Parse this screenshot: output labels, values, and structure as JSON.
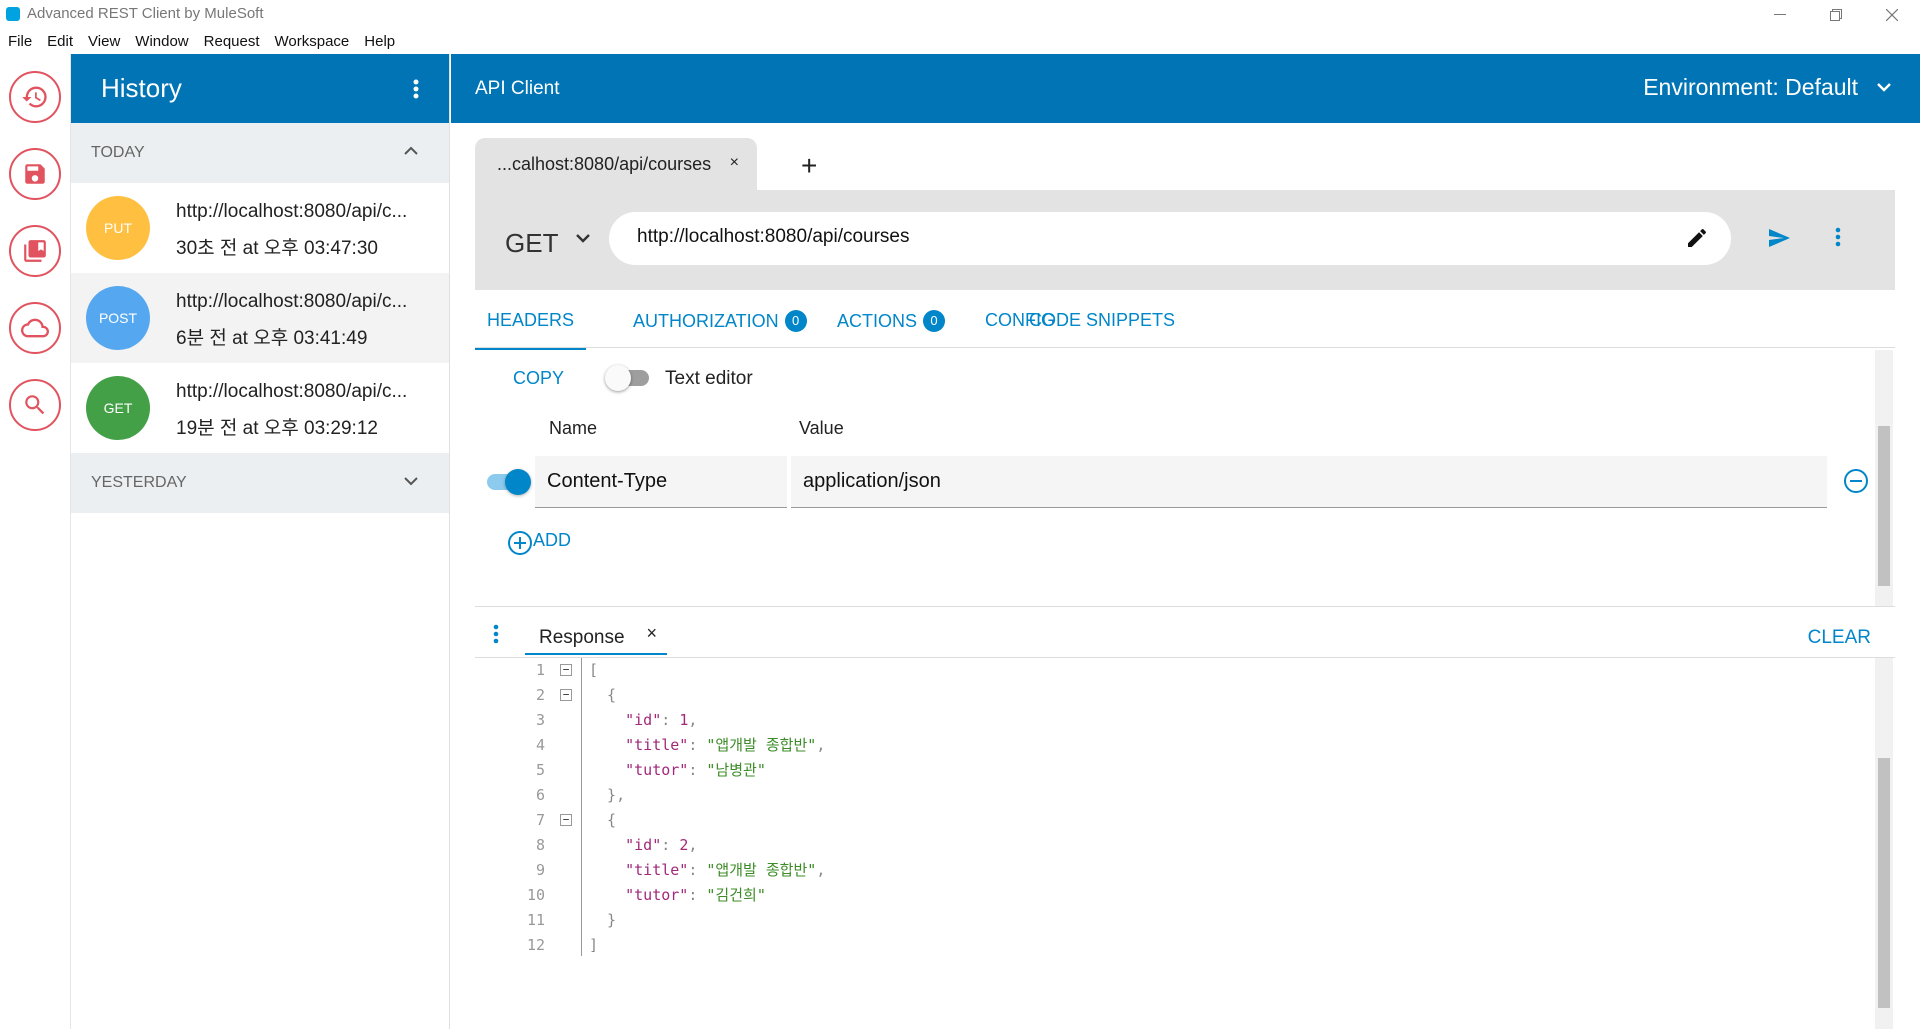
{
  "window": {
    "title": "Advanced REST Client by MuleSoft"
  },
  "menu": [
    "File",
    "Edit",
    "View",
    "Window",
    "Request",
    "Workspace",
    "Help"
  ],
  "rail": [
    "history-icon",
    "save-icon",
    "saved-requests-icon",
    "cloud-icon",
    "search-icon"
  ],
  "sidebar": {
    "title": "History",
    "today_label": "TODAY",
    "yesterday_label": "YESTERDAY",
    "items": [
      {
        "method": "PUT",
        "color": "#ffc042",
        "url": "http://localhost:8080/api/c...",
        "time": "30초 전 at 오후 03:47:30"
      },
      {
        "method": "POST",
        "color": "#55a8f0",
        "url": "http://localhost:8080/api/c...",
        "time": "6분 전 at 오후 03:41:49"
      },
      {
        "method": "GET",
        "color": "#43a047",
        "url": "http://localhost:8080/api/c...",
        "time": "19분 전 at 오후 03:29:12"
      }
    ]
  },
  "topbar": {
    "title": "API Client",
    "environment": "Environment: Default"
  },
  "request_tab": {
    "label": "...calhost:8080/api/courses",
    "close": "×",
    "add": "+"
  },
  "request": {
    "method": "GET",
    "url": "http://localhost:8080/api/courses"
  },
  "tabs": {
    "headers": "HEADERS",
    "authorization": "AUTHORIZATION",
    "authorization_count": "0",
    "actions": "ACTIONS",
    "actions_count": "0",
    "config": "CONFIG",
    "code_snippets": "CODE SNIPPETS"
  },
  "headers_panel": {
    "copy": "COPY",
    "text_editor": "Text editor",
    "name_col": "Name",
    "value_col": "Value",
    "rows": [
      {
        "name": "Content-Type",
        "value": "application/json",
        "enabled": true
      }
    ],
    "add": "ADD"
  },
  "response": {
    "tab_label": "Response",
    "close": "×",
    "clear": "CLEAR",
    "lines": [
      "1",
      "2",
      "3",
      "4",
      "5",
      "6",
      "7",
      "8",
      "9",
      "10",
      "11",
      "12"
    ],
    "course1": {
      "id": "1",
      "title": "\"앱개발 종합반\"",
      "tutor": "\"남병관\""
    },
    "course2": {
      "id": "2",
      "title": "\"앱개발 종합반\"",
      "tutor": "\"김건희\""
    }
  },
  "colors": {
    "primary": "#0074b4",
    "accent": "#0086c9",
    "rail_icon": "#e0535f"
  }
}
